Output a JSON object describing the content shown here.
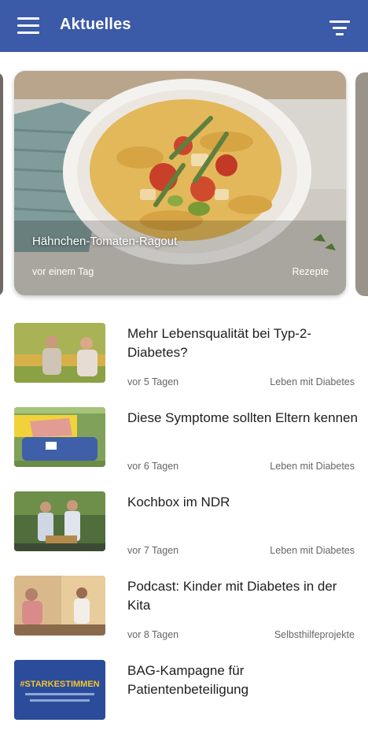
{
  "appbar": {
    "title": "Aktuelles",
    "menu_icon": "hamburger-menu-icon",
    "filter_icon": "filter-icon",
    "color": "#3b5aa8"
  },
  "featured": {
    "title": "Hähnchen-Tomaten-Ragout",
    "time": "vor einem Tag",
    "category": "Rezepte"
  },
  "articles": [
    {
      "headline": "Mehr Lebensqualität bei Typ-2-Diabetes?",
      "time": "vor 5 Tagen",
      "category": "Leben mit Diabetes"
    },
    {
      "headline": "Diese Symptome sollten Eltern kennen",
      "time": "vor 6 Tagen",
      "category": "Leben mit Diabetes"
    },
    {
      "headline": "Kochbox im NDR",
      "time": "vor 7 Tagen",
      "category": "Leben mit Diabetes"
    },
    {
      "headline": "Podcast: Kinder mit Diabetes in der Kita",
      "time": "vor 8 Tagen",
      "category": "Selbsthilfeprojekte"
    },
    {
      "headline": "BAG-Kampagne für Patientenbeteiligung",
      "time": "",
      "category": ""
    }
  ],
  "thumb5_text": "#STARKESTIMMEN"
}
